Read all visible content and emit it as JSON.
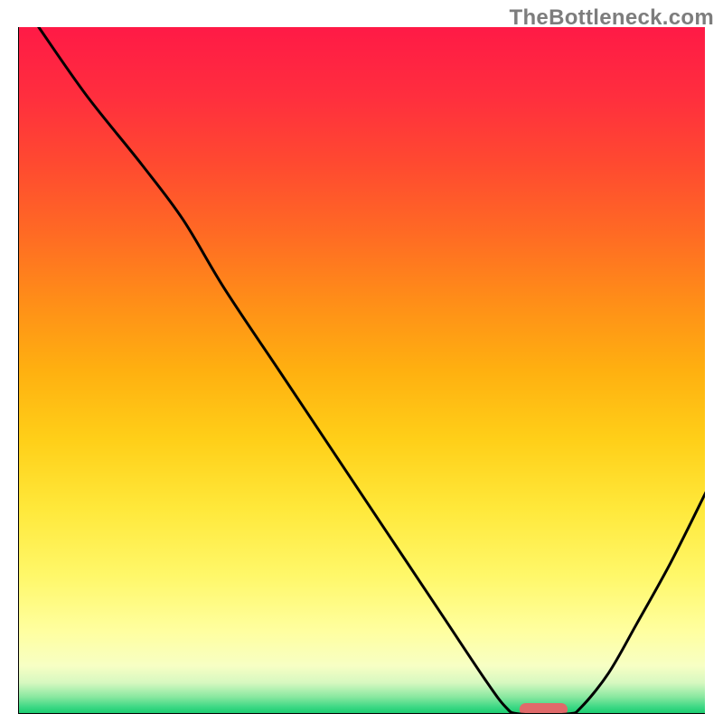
{
  "watermark": "TheBottleneck.com",
  "chart_data": {
    "type": "line",
    "title": "",
    "xlabel": "",
    "ylabel": "",
    "xlim": [
      0,
      100
    ],
    "ylim": [
      0,
      100
    ],
    "gradient_stops": [
      {
        "pos": 0.0,
        "color": "#ff1a46"
      },
      {
        "pos": 0.1,
        "color": "#ff2e3e"
      },
      {
        "pos": 0.2,
        "color": "#ff4a30"
      },
      {
        "pos": 0.3,
        "color": "#ff6a24"
      },
      {
        "pos": 0.4,
        "color": "#ff8e18"
      },
      {
        "pos": 0.5,
        "color": "#ffb010"
      },
      {
        "pos": 0.6,
        "color": "#ffcf18"
      },
      {
        "pos": 0.7,
        "color": "#ffe83a"
      },
      {
        "pos": 0.8,
        "color": "#fff86a"
      },
      {
        "pos": 0.88,
        "color": "#ffffa0"
      },
      {
        "pos": 0.93,
        "color": "#f7ffc4"
      },
      {
        "pos": 0.955,
        "color": "#d6f8c0"
      },
      {
        "pos": 0.975,
        "color": "#8ae8a0"
      },
      {
        "pos": 0.99,
        "color": "#3cd884"
      },
      {
        "pos": 1.0,
        "color": "#18cc6e"
      }
    ],
    "series": [
      {
        "name": "curve",
        "type": "line",
        "color": "#000000",
        "points": [
          {
            "x": 3,
            "y": 100
          },
          {
            "x": 10,
            "y": 90
          },
          {
            "x": 18,
            "y": 80
          },
          {
            "x": 24,
            "y": 72
          },
          {
            "x": 30,
            "y": 62
          },
          {
            "x": 38,
            "y": 50
          },
          {
            "x": 46,
            "y": 38
          },
          {
            "x": 54,
            "y": 26
          },
          {
            "x": 62,
            "y": 14
          },
          {
            "x": 68,
            "y": 5
          },
          {
            "x": 71,
            "y": 1
          },
          {
            "x": 73,
            "y": 0
          },
          {
            "x": 80,
            "y": 0
          },
          {
            "x": 82,
            "y": 1
          },
          {
            "x": 86,
            "y": 6
          },
          {
            "x": 90,
            "y": 13
          },
          {
            "x": 95,
            "y": 22
          },
          {
            "x": 100,
            "y": 32
          }
        ]
      }
    ],
    "marker": {
      "color": "#e06a6a",
      "x_start": 73,
      "x_end": 80,
      "y": 0
    },
    "axes": {
      "color": "#000000",
      "width": 2
    }
  }
}
